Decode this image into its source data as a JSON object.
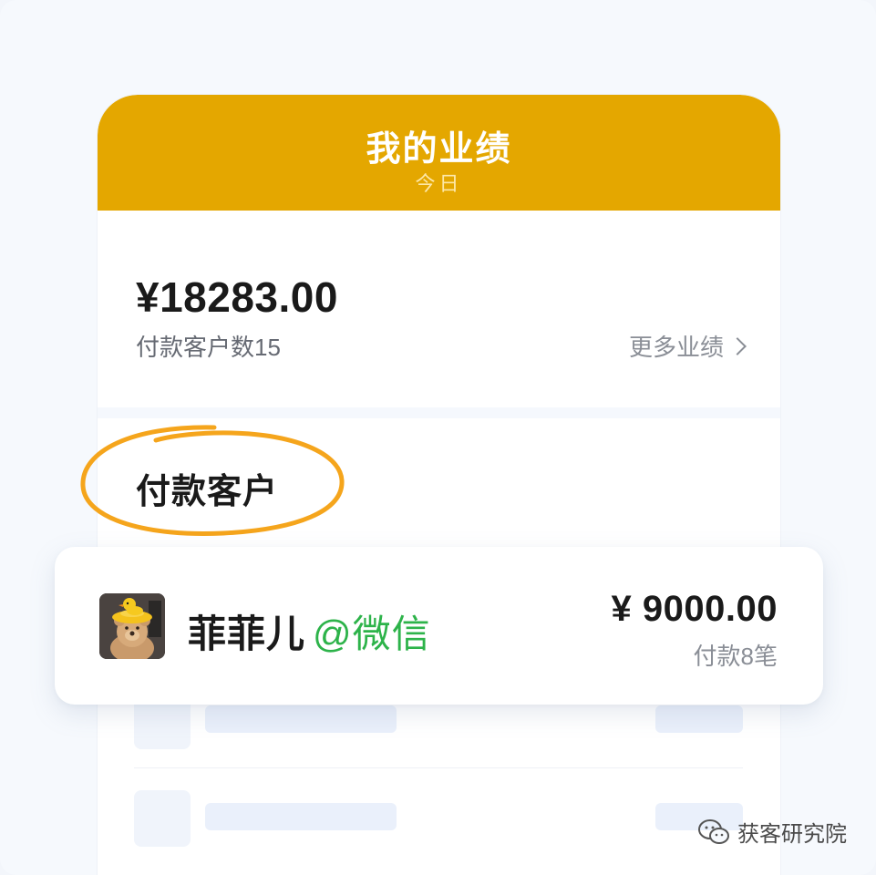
{
  "header": {
    "title": "我的业绩",
    "subtitle": "今日"
  },
  "summary": {
    "amount": "¥18283.00",
    "customers_count": "付款客户数15",
    "more_link": "更多业绩"
  },
  "section": {
    "title": "付款客户"
  },
  "customer_card": {
    "name": "菲菲儿",
    "source": "@微信",
    "amount": "¥ 9000.00",
    "payments": "付款8笔"
  },
  "watermark": {
    "text": "获客研究院"
  },
  "colors": {
    "header_bg": "#e4a700",
    "highlight_circle": "#f5a51c",
    "source_green": "#2db34a"
  }
}
